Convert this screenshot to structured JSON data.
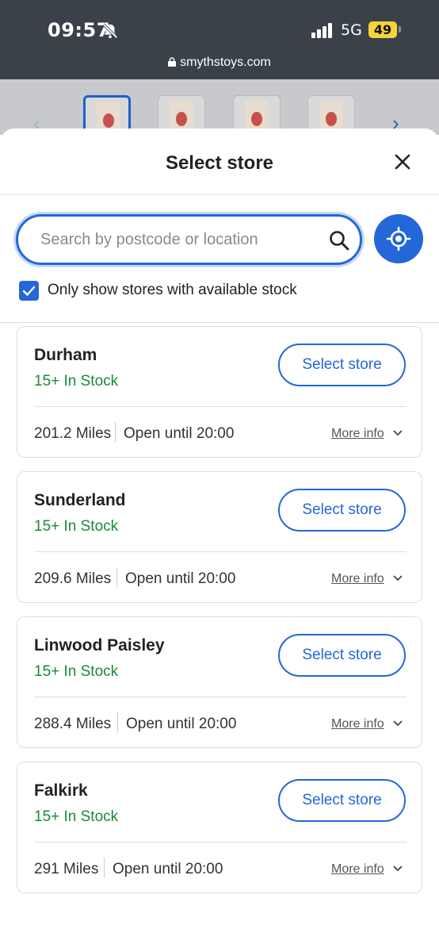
{
  "status_bar": {
    "time": "09:57",
    "network": "5G",
    "battery": "49",
    "url": "smythstoys.com"
  },
  "sheet": {
    "title": "Select store",
    "search": {
      "placeholder": "Search by postcode or location",
      "value": ""
    },
    "filter": {
      "label": "Only show stores with available stock",
      "checked": true
    }
  },
  "stores": [
    {
      "name": "Durham",
      "stock": "15+ In Stock",
      "distance": "201.2 Miles",
      "hours": "Open until 20:00",
      "select_label": "Select store",
      "more_info": "More info"
    },
    {
      "name": "Sunderland",
      "stock": "15+ In Stock",
      "distance": "209.6 Miles",
      "hours": "Open until 20:00",
      "select_label": "Select store",
      "more_info": "More info"
    },
    {
      "name": "Linwood Paisley",
      "stock": "15+ In Stock",
      "distance": "288.4 Miles",
      "hours": "Open until 20:00",
      "select_label": "Select store",
      "more_info": "More info"
    },
    {
      "name": "Falkirk",
      "stock": "15+ In Stock",
      "distance": "291 Miles",
      "hours": "Open until 20:00",
      "select_label": "Select store",
      "more_info": "More info"
    }
  ],
  "colors": {
    "accent": "#2467d8",
    "stock_green": "#1b8a3a",
    "status_bar": "#3b4148"
  },
  "icons": [
    "bell-slash-icon",
    "signal-icon",
    "battery-icon",
    "lock-icon",
    "close-icon",
    "search-icon",
    "locate-icon",
    "checkmark-icon",
    "chevron-down-icon",
    "chevron-left-icon",
    "chevron-right-icon"
  ]
}
